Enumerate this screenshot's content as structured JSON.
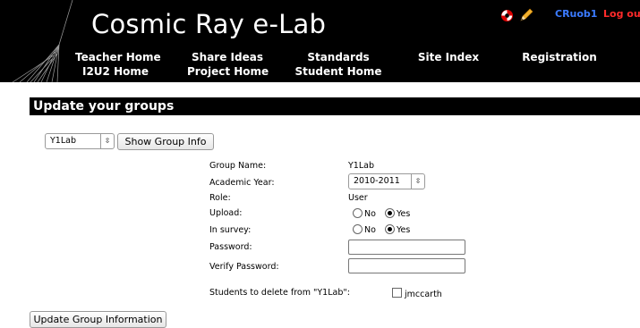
{
  "header": {
    "site_title": "Cosmic Ray e-Lab",
    "user": "CRuob1",
    "logout": "Log out",
    "nav": [
      {
        "line1": "Teacher Home",
        "line2": "I2U2 Home"
      },
      {
        "line1": "Share Ideas",
        "line2": "Project Home"
      },
      {
        "line1": "Standards",
        "line2": "Student Home"
      },
      {
        "line1": "Site Index",
        "line2": ""
      },
      {
        "line1": "Registration",
        "line2": ""
      }
    ],
    "icons": {
      "help": "lifebuoy-icon",
      "edit": "pencil-icon"
    },
    "colors": {
      "user_link": "#3b7bff",
      "logout_link": "#ff2a2a",
      "bar": "#000000"
    }
  },
  "section_title": "Update your groups",
  "group_select": {
    "value": "Y1Lab",
    "show_button": "Show Group Info"
  },
  "form": {
    "group_name_label": "Group Name:",
    "group_name_value": "Y1Lab",
    "academic_year_label": "Academic Year:",
    "academic_year_value": "2010-2011",
    "role_label": "Role:",
    "role_value": "User",
    "upload_label": "Upload:",
    "upload_options": [
      "No",
      "Yes"
    ],
    "upload_selected": "Yes",
    "survey_label": "In survey:",
    "survey_options": [
      "No",
      "Yes"
    ],
    "survey_selected": "Yes",
    "password_label": "Password:",
    "password_value": "",
    "verify_label": "Verify Password:",
    "verify_value": "",
    "delete_label": "Students to delete from \"Y1Lab\":",
    "students": [
      {
        "name": "jmccarth",
        "checked": false
      }
    ]
  },
  "submit_button": "Update Group Information"
}
